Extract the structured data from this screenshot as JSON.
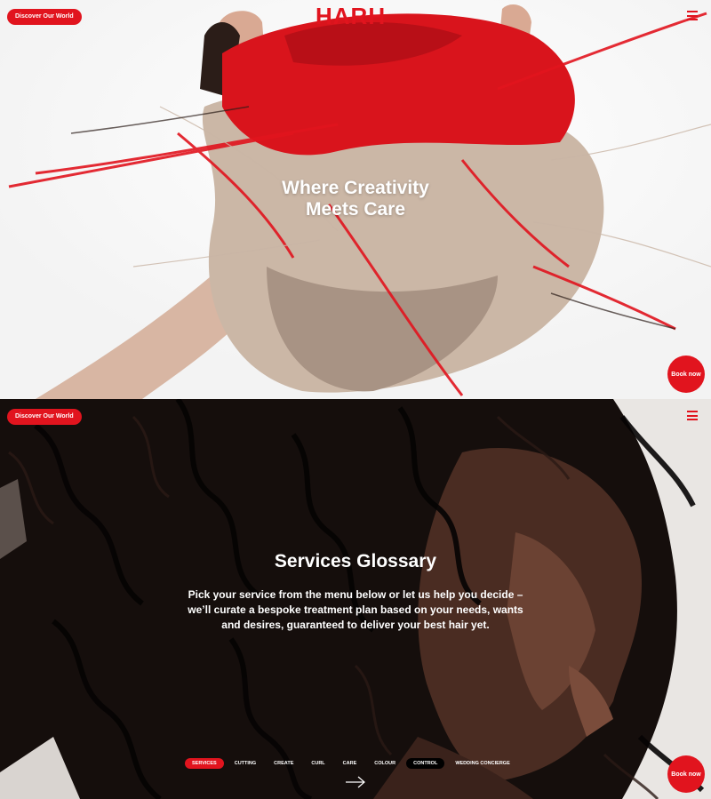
{
  "brand": "HARH",
  "colors": {
    "accent": "#e1141e",
    "hair_red": "#d9141c",
    "dark_bg": "#140d0b"
  },
  "hero": {
    "discover_label": "Discover Our World",
    "title_line1": "Where Creativity",
    "title_line2": "Meets Care",
    "book_label": "Book now",
    "menu_icon": "hamburger-icon"
  },
  "services": {
    "discover_label": "Discover Our World",
    "title": "Services Glossary",
    "description": "Pick your service from the menu below or let us help you decide – we’ll curate a bespoke treatment plan based on your needs, wants and desires, guaranteed to deliver your best hair yet.",
    "tabs": [
      {
        "label": "SERVICES",
        "state": "active"
      },
      {
        "label": "CUTTING",
        "state": ""
      },
      {
        "label": "CREATE",
        "state": ""
      },
      {
        "label": "CURL",
        "state": ""
      },
      {
        "label": "CARE",
        "state": ""
      },
      {
        "label": "COLOUR",
        "state": ""
      },
      {
        "label": "CONTROL",
        "state": "dark"
      },
      {
        "label": "WEDDING CONCIERGE",
        "state": ""
      }
    ],
    "book_label": "Book now",
    "next_icon": "arrow-right-icon",
    "menu_icon": "hamburger-icon"
  }
}
